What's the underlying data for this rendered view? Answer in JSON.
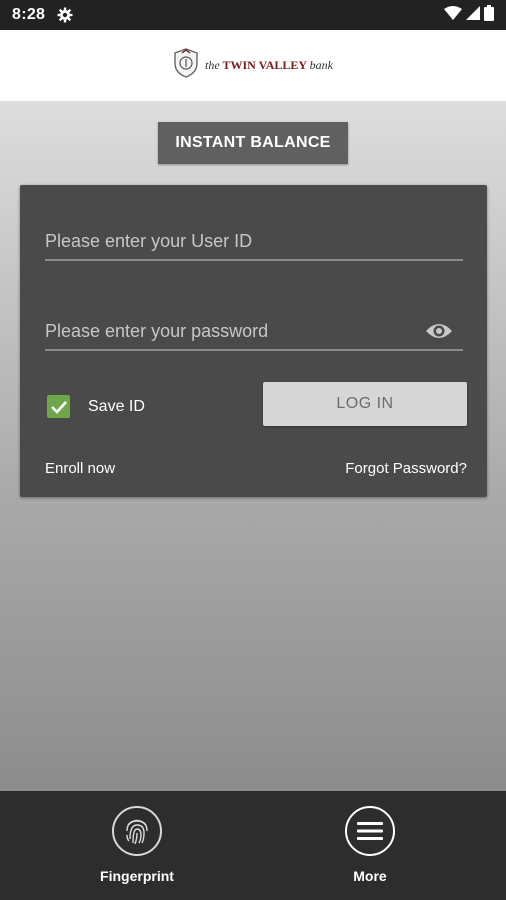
{
  "status_bar": {
    "time": "8:28",
    "icons": [
      "settings-gear-icon",
      "wifi-icon",
      "signal-icon",
      "battery-icon"
    ]
  },
  "header": {
    "logo": {
      "prefix": "the",
      "name": "TWIN VALLEY",
      "suffix": "bank",
      "icon": "bank-seal-icon"
    }
  },
  "instant_balance_label": "INSTANT BALANCE",
  "login": {
    "user_id_placeholder": "Please enter your User ID",
    "user_id_value": "",
    "password_placeholder": "Please enter your password",
    "password_value": "",
    "password_toggle_icon": "eye-icon",
    "save_id_label": "Save ID",
    "save_id_checked": true,
    "login_button": "LOG IN",
    "enroll_link": "Enroll now",
    "forgot_link": "Forgot Password?"
  },
  "bottom_nav": {
    "items": [
      {
        "label": "Fingerprint",
        "icon": "fingerprint-icon"
      },
      {
        "label": "More",
        "icon": "menu-icon"
      }
    ]
  },
  "colors": {
    "status_bar": "#222222",
    "header_bg": "#ffffff",
    "card_bg": "#4a4a4a",
    "instant_balance_bg": "#606060",
    "checkbox_green": "#6ea64a",
    "login_button_bg": "#d6d6d6",
    "bottom_nav_bg": "#2d2d2d",
    "logo_red": "#7a1a1a"
  }
}
